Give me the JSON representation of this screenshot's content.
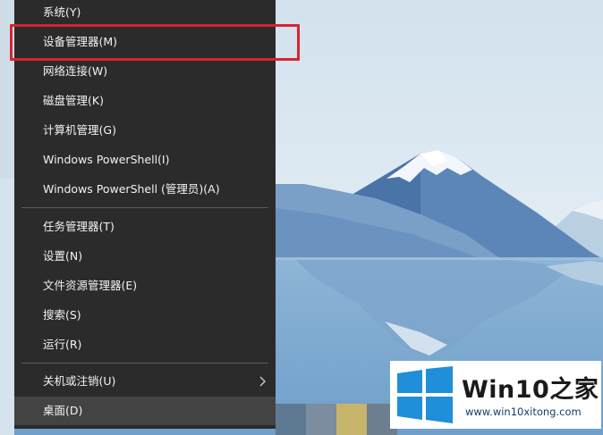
{
  "menu": {
    "items_group1": [
      {
        "label": "系统(Y)"
      },
      {
        "label": "设备管理器(M)"
      },
      {
        "label": "网络连接(W)"
      },
      {
        "label": "磁盘管理(K)"
      },
      {
        "label": "计算机管理(G)"
      },
      {
        "label": "Windows PowerShell(I)"
      },
      {
        "label": "Windows PowerShell (管理员)(A)"
      }
    ],
    "items_group2": [
      {
        "label": "任务管理器(T)"
      },
      {
        "label": "设置(N)"
      },
      {
        "label": "文件资源管理器(E)"
      },
      {
        "label": "搜索(S)"
      },
      {
        "label": "运行(R)"
      }
    ],
    "items_group3": [
      {
        "label": "关机或注销(U)",
        "submenu_icon": "chevron-right-icon"
      },
      {
        "label": "桌面(D)"
      }
    ],
    "highlighted_item": "设备管理器(M)",
    "hovered_item": "桌面(D)"
  },
  "watermark": {
    "brand": "Win10之家",
    "url": "www.win10xitong.com"
  },
  "colors": {
    "menu_bg": "#2b2b2b",
    "menu_hover": "#434343",
    "highlight_border": "#d9232e",
    "windows_logo": "#1e8fd8"
  }
}
